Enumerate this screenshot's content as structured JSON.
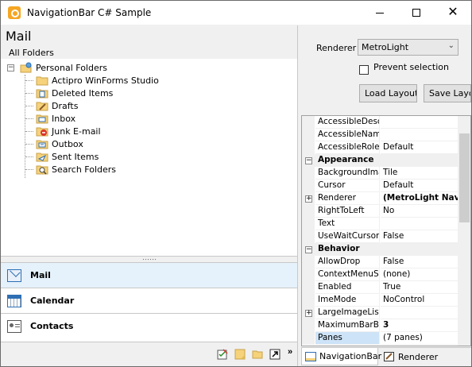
{
  "window": {
    "title": "NavigationBar C# Sample",
    "minimize": "",
    "maximize": "",
    "close": "✕"
  },
  "navbar": {
    "header_title": "Mail",
    "header_subtitle": "All Folders",
    "tree": {
      "root": {
        "label": "Personal Folders",
        "expander": "−",
        "icon": "personal-folders-icon"
      },
      "items": [
        {
          "label": "Actipro WinForms Studio",
          "icon": "folder-icon"
        },
        {
          "label": "Deleted Items",
          "icon": "deleted-items-icon"
        },
        {
          "label": "Drafts",
          "icon": "drafts-icon"
        },
        {
          "label": "Inbox",
          "icon": "inbox-icon"
        },
        {
          "label": "Junk E-mail",
          "icon": "junk-email-icon"
        },
        {
          "label": "Outbox",
          "icon": "outbox-icon"
        },
        {
          "label": "Sent Items",
          "icon": "sent-items-icon"
        },
        {
          "label": "Search Folders",
          "icon": "search-folder-icon"
        }
      ]
    },
    "buttons": [
      {
        "label": "Mail",
        "icon": "mail-icon",
        "selected": true
      },
      {
        "label": "Calendar",
        "icon": "calendar-icon",
        "selected": false
      },
      {
        "label": "Contacts",
        "icon": "contacts-icon",
        "selected": false
      }
    ],
    "overflow_icons": [
      "tasks-icon",
      "notes-icon",
      "folder-list-icon",
      "shortcuts-icon"
    ],
    "overflow_chevron": "»"
  },
  "options": {
    "renderer_label": "Renderer",
    "renderer_value": "MetroLight",
    "renderer_arrow": "⌄",
    "prevent_selection_label": "Prevent selection",
    "prevent_selection_checked": false,
    "load_layout_label": "Load Layout",
    "save_layout_label": "Save Layout"
  },
  "property_grid": {
    "rows": [
      {
        "kind": "prop",
        "name": "AccessibleDescri",
        "value": ""
      },
      {
        "kind": "prop",
        "name": "AccessibleName",
        "value": ""
      },
      {
        "kind": "prop",
        "name": "AccessibleRole",
        "value": "Default"
      },
      {
        "kind": "category",
        "name": "Appearance",
        "expander": "−"
      },
      {
        "kind": "prop",
        "name": "BackgroundImag",
        "value": "Tile"
      },
      {
        "kind": "prop",
        "name": "Cursor",
        "value": "Default"
      },
      {
        "kind": "prop",
        "name": "Renderer",
        "value": "(MetroLight Navig",
        "bold": true,
        "expander": "+"
      },
      {
        "kind": "prop",
        "name": "RightToLeft",
        "value": "No"
      },
      {
        "kind": "prop",
        "name": "Text",
        "value": ""
      },
      {
        "kind": "prop",
        "name": "UseWaitCursor",
        "value": "False"
      },
      {
        "kind": "category",
        "name": "Behavior",
        "expander": "−"
      },
      {
        "kind": "prop",
        "name": "AllowDrop",
        "value": "False"
      },
      {
        "kind": "prop",
        "name": "ContextMenuStri",
        "value": "(none)"
      },
      {
        "kind": "prop",
        "name": "Enabled",
        "value": "True"
      },
      {
        "kind": "prop",
        "name": "ImeMode",
        "value": "NoControl"
      },
      {
        "kind": "prop",
        "name": "LargeImageList",
        "value": "",
        "expander": "+"
      },
      {
        "kind": "prop",
        "name": "MaximumBarButt",
        "value": "3",
        "bold": true
      },
      {
        "kind": "prop",
        "name": "Panes",
        "value": "(7 panes)",
        "selected": true
      }
    ]
  },
  "tabs": [
    {
      "label": "NavigationBar",
      "icon": "navigationbar-icon",
      "active": true
    },
    {
      "label": "Renderer",
      "icon": "renderer-icon",
      "active": false
    }
  ]
}
